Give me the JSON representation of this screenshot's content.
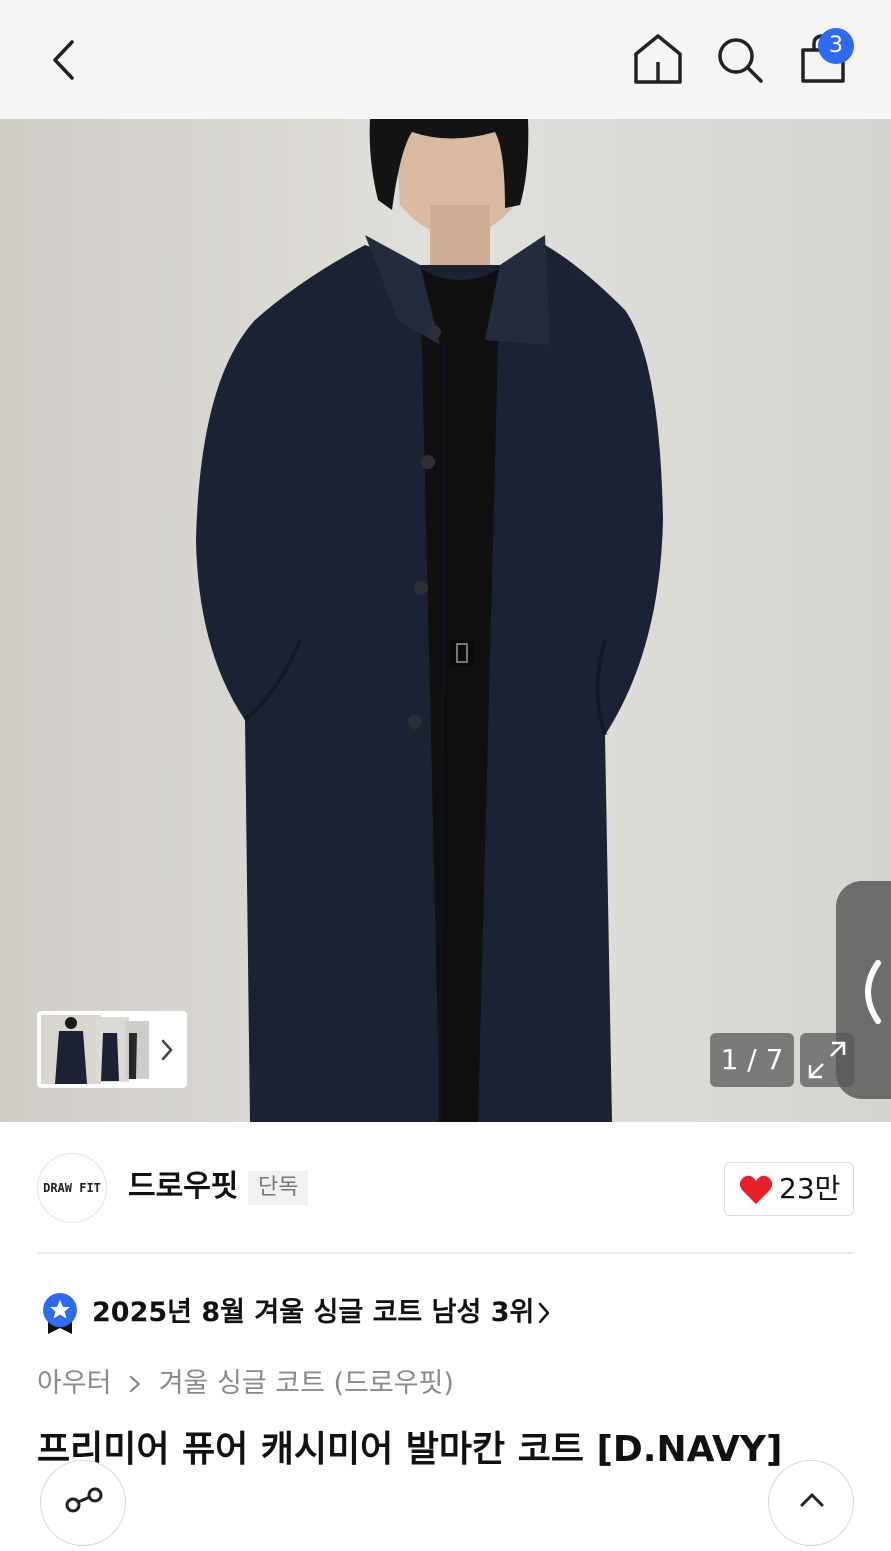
{
  "header": {
    "back_icon": "chevron-left-icon",
    "home_icon": "home-icon",
    "search_icon": "search-icon",
    "cart_icon": "shopping-bag-icon",
    "cart_count": "3"
  },
  "gallery": {
    "counter": "1 / 7",
    "expand_icon": "expand-icon",
    "thumb_more_icon": "chevron-right-icon",
    "side_tab_icon": "chevron-left-icon"
  },
  "brand": {
    "logo_text": "DRAW FIT",
    "name": "드로우핏",
    "exclusive_badge": "단독",
    "like_count": "23만",
    "like_icon": "heart-icon"
  },
  "ranking": {
    "icon": "ranking-medal-icon",
    "text": "2025년 8월 겨울 싱글 코트 남성 3위"
  },
  "breadcrumb": {
    "items": [
      "아우터",
      "겨울 싱글 코트 (드로우핏)"
    ]
  },
  "product": {
    "title": "프리미어 퓨어 캐시미어 발마칸 코트 [D.NAVY]"
  },
  "colors": {
    "accent": "#2f6bf2",
    "like": "#e8202a",
    "coat": "#1b2233"
  }
}
